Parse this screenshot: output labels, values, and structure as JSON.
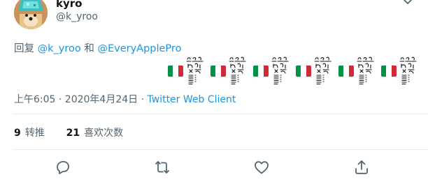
{
  "author": {
    "display_name": "kyro",
    "handle": "@k_yroo"
  },
  "reply": {
    "prefix": "回复",
    "mention_1": "@k_yroo",
    "conjunction": "和",
    "mention_2": "@EveryApplePro"
  },
  "tweet": {
    "emoji_units": [
      {
        "flag": "italy-flag-emoji",
        "glyph": "scribble-ascii-art"
      },
      {
        "flag": "italy-flag-emoji",
        "glyph": "scribble-ascii-art"
      },
      {
        "flag": "italy-flag-emoji",
        "glyph": "scribble-ascii-art"
      },
      {
        "flag": "italy-flag-emoji",
        "glyph": "scribble-ascii-art"
      },
      {
        "flag": "italy-flag-emoji",
        "glyph": "scribble-ascii-art"
      },
      {
        "flag": "italy-flag-emoji",
        "glyph": "scribble-ascii-art"
      }
    ],
    "flag_colors": [
      "#009246",
      "#ffffff",
      "#ce2b37"
    ]
  },
  "meta": {
    "timestamp": "上午6:05 · 2020年4月24日",
    "separator": " · ",
    "source": "Twitter Web Client"
  },
  "stats": {
    "retweets_count": "9",
    "retweets_label": "转推",
    "likes_count": "21",
    "likes_label": "喜欢次数"
  },
  "actions": [
    "reply-icon",
    "retweet-icon",
    "like-icon",
    "share-icon"
  ],
  "colors": {
    "link": "#1b95e0",
    "muted": "#536471",
    "text": "#0f1419",
    "divider": "#e6ecf0"
  }
}
